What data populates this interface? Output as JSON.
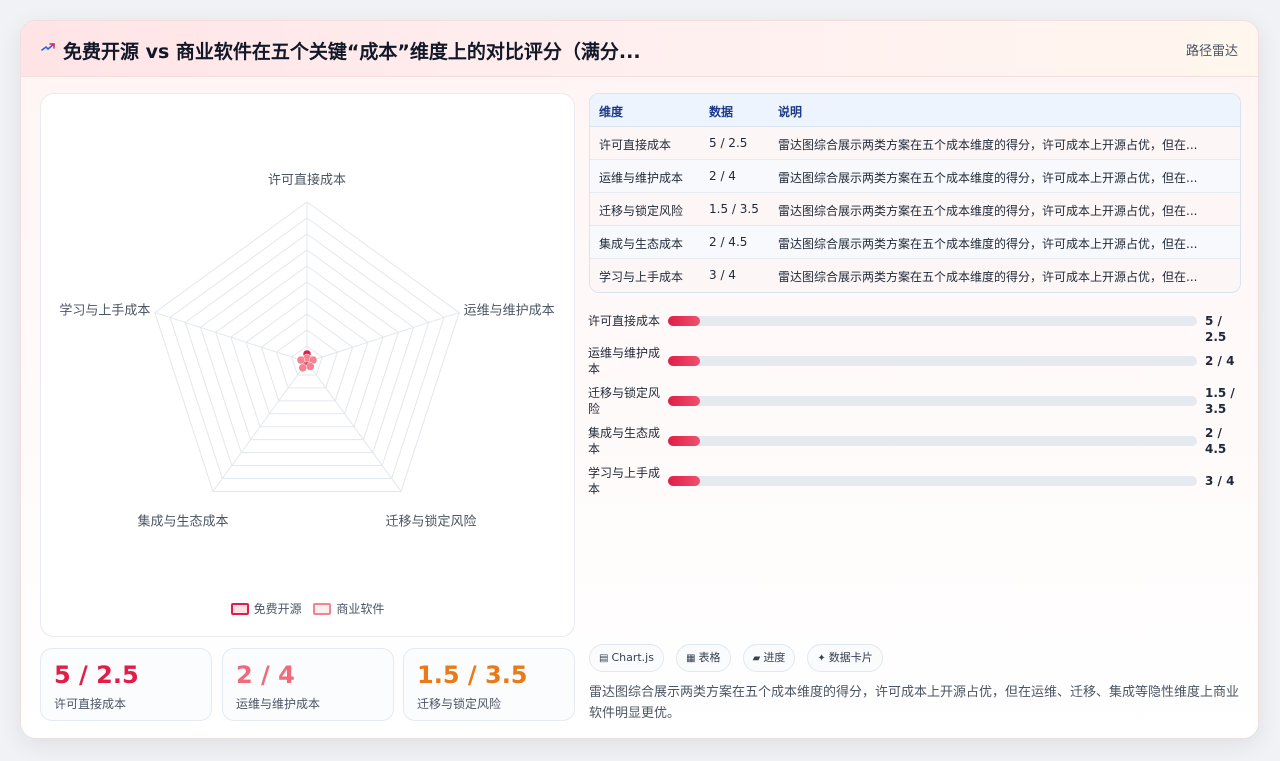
{
  "header": {
    "icon": "sparkle-icon",
    "title": "免费开源 vs 商业软件在五个关键“成本”维度上的对比评分（满分...",
    "right_label": "路径雷达"
  },
  "colors": {
    "accent": "#e11d48",
    "accent_light": "#f2838f",
    "orange": "#ea7a17",
    "pink": "#f06a7d"
  },
  "chart_data": {
    "type": "radar",
    "categories": [
      "许可直接成本",
      "运维与维护成本",
      "迁移与锁定风险",
      "集成与生态成本",
      "学习与上手成本"
    ],
    "series": [
      {
        "name": "免费开源",
        "values": [
          5,
          2,
          1.5,
          2,
          3
        ]
      },
      {
        "name": "商业软件",
        "values": [
          2.5,
          4,
          3.5,
          4.5,
          4
        ]
      }
    ],
    "rlim": [
      0,
      100
    ],
    "grid": true,
    "legend": "bottom"
  },
  "stats": [
    {
      "value": "5 / 2.5",
      "label": "许可直接成本"
    },
    {
      "value": "2 / 4",
      "label": "运维与维护成本"
    },
    {
      "value": "1.5 / 3.5",
      "label": "迁移与锁定风险"
    }
  ],
  "table": {
    "headers": [
      "维度",
      "数据",
      "说明"
    ],
    "rows": [
      [
        "许可直接成本",
        "5 / 2.5",
        "雷达图综合展示两类方案在五个成本维度的得分，许可成本上开源占优，但在..."
      ],
      [
        "运维与维护成本",
        "2 / 4",
        "雷达图综合展示两类方案在五个成本维度的得分，许可成本上开源占优，但在..."
      ],
      [
        "迁移与锁定风险",
        "1.5 / 3.5",
        "雷达图综合展示两类方案在五个成本维度的得分，许可成本上开源占优，但在..."
      ],
      [
        "集成与生态成本",
        "2 / 4.5",
        "雷达图综合展示两类方案在五个成本维度的得分，许可成本上开源占优，但在..."
      ],
      [
        "学习与上手成本",
        "3 / 4",
        "雷达图综合展示两类方案在五个成本维度的得分，许可成本上开源占优，但在..."
      ]
    ]
  },
  "progress": [
    {
      "label": "许可直接成本",
      "value": "5 / 2.5",
      "fraction": 0.06
    },
    {
      "label": "运维与维护成本",
      "value": "2 / 4",
      "fraction": 0.06
    },
    {
      "label": "迁移与锁定风险",
      "value": "1.5 / 3.5",
      "fraction": 0.06
    },
    {
      "label": "集成与生态成本",
      "value": "2 / 4.5",
      "fraction": 0.06
    },
    {
      "label": "学习与上手成本",
      "value": "3 / 4",
      "fraction": 0.06
    }
  ],
  "chips": [
    {
      "icon": "chart-icon",
      "glyph": "▤",
      "label": "Chart.js"
    },
    {
      "icon": "table-icon",
      "glyph": "▦",
      "label": "表格"
    },
    {
      "icon": "progress-icon",
      "glyph": "▰",
      "label": "进度"
    },
    {
      "icon": "card-icon",
      "glyph": "✦",
      "label": "数据卡片"
    }
  ],
  "description": "雷达图综合展示两类方案在五个成本维度的得分，许可成本上开源占优，但在运维、迁移、集成等隐性维度上商业软件明显更优。"
}
